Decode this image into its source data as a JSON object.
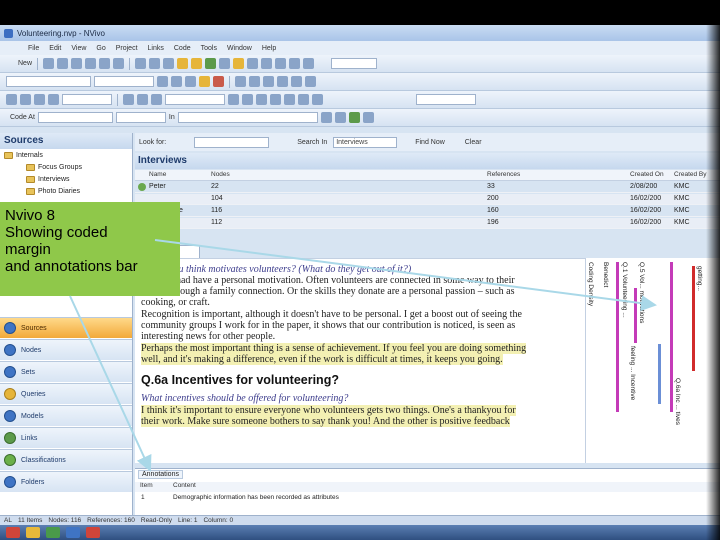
{
  "window": {
    "title": "Volunteering.nvp - NVivo"
  },
  "menu": [
    "File",
    "Edit",
    "View",
    "Go",
    "Project",
    "Links",
    "Code",
    "Tools",
    "Window",
    "Help"
  ],
  "toolbar1": {
    "new_label": "New"
  },
  "toolbar4": {
    "code_at_label": "Code At",
    "in_label": "In"
  },
  "sources_pane": {
    "title": "Sources",
    "tree": [
      {
        "label": "Internals",
        "level": 0
      },
      {
        "label": "Focus Groups",
        "level": 1
      },
      {
        "label": "Interviews",
        "level": 1
      },
      {
        "label": "Photo Diaries",
        "level": 1
      }
    ]
  },
  "nav_buttons": [
    {
      "label": "Sources",
      "active": true
    },
    {
      "label": "Nodes",
      "active": false
    },
    {
      "label": "Sets",
      "active": false
    },
    {
      "label": "Queries",
      "active": false
    },
    {
      "label": "Models",
      "active": false
    },
    {
      "label": "Links",
      "active": false
    },
    {
      "label": "Classifications",
      "active": false
    },
    {
      "label": "Folders",
      "active": false
    }
  ],
  "find_bar": {
    "look_for_label": "Look for:",
    "search_in_label": "Search In",
    "search_in_value": "Interviews",
    "find_now_label": "Find Now",
    "clear_label": "Clear"
  },
  "list": {
    "title": "Interviews",
    "columns": [
      "Name",
      "Nodes",
      "References",
      "Created On",
      "Created By"
    ],
    "rows": [
      {
        "name": "Peter",
        "nodes": "22",
        "refs": "33",
        "created_on": "2/08/200",
        "by": "KMC"
      },
      {
        "name": "",
        "nodes": "104",
        "refs": "200",
        "created_on": "16/02/200",
        "by": "KMC"
      },
      {
        "name": "e",
        "nodes": "116",
        "refs": "160",
        "created_on": "16/02/200",
        "by": "KMC"
      },
      {
        "name": "",
        "nodes": "112",
        "refs": "196",
        "created_on": "16/02/200",
        "by": "KMC"
      }
    ]
  },
  "detail": {
    "tab_label": "e",
    "q5_question": "you think motivates volunteers? (What do they get out of it?)",
    "p1": "e had have a personal motivation. Often volunteers are connected in some way to their",
    "p2": "through a family connection. Or the skills they donate are a personal passion – such as",
    "p3": "cooking, or craft.",
    "p4": "Recognition is important, although it doesn't have to be personal. I get a boost out of seeing the",
    "p5": "community groups I work for in the paper, it shows that our contribution is noticed, is seen as",
    "p6": "interesting news for other people.",
    "p7": "Perhaps the most important thing is a sense of achievement. If you feel you are doing something",
    "p8": "well, and it's making a difference, even if the work is difficult at times, it keeps you going.",
    "q6_heading": "Q.6a Incentives for volunteering?",
    "q6_question": "What incentives should be offered for volunteering?",
    "p9": "I think it's important to ensure everyone who volunteers gets two things. One's a thankyou for",
    "p10": "their work. Make sure someone bothers to say thank you! And the other is positive feedback"
  },
  "stripes": [
    {
      "label": "Coding Density",
      "color": "#7a7a7a"
    },
    {
      "label": "Benedict",
      "color": "#c0c0c0"
    },
    {
      "label": "Q.1 Volunteering ... ",
      "color": "#c43bb8"
    },
    {
      "label": "Q.5 Vol... motivations",
      "color": "#c43bb8"
    },
    {
      "label": "feeling ... Incentive",
      "color": "#6b8fd6"
    },
    {
      "label": "Q.6a Inc ... tives",
      "color": "#c43bb8"
    },
    {
      "label": "getting... ",
      "color": "#d12b2b"
    }
  ],
  "annotations": {
    "tab_label": "Annotations",
    "columns": [
      "Item",
      "Content"
    ],
    "rows": [
      {
        "item": "1",
        "content": "Demographic information has been recorded as attributes"
      }
    ]
  },
  "status": {
    "items": [
      "AL",
      "11 Items",
      "Nodes: 116",
      "References: 160",
      "Read-Only",
      "Line: 1",
      "Column: 0"
    ]
  },
  "callout": {
    "line1": "Nvivo 8",
    "line2": "Showing  coded",
    "line3": "margin",
    "line4": "and annotations  bar"
  }
}
